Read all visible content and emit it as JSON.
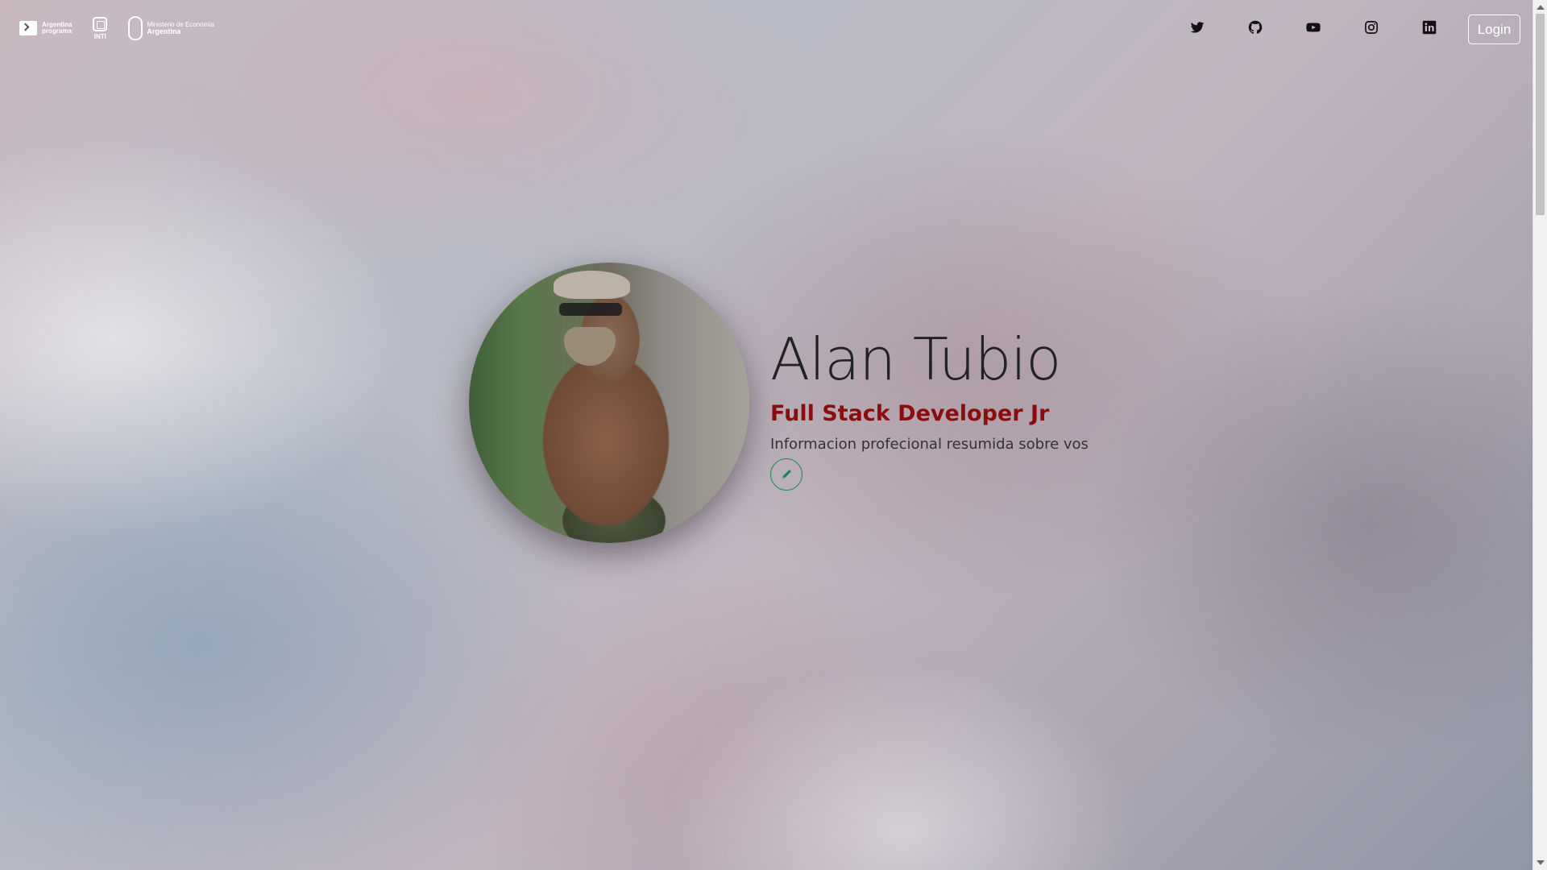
{
  "header": {
    "logos": {
      "argentina_programa": "Argentina\nprograma",
      "inti": "INTI",
      "ministerio_line1": "Ministerio de Economía",
      "ministerio_line2": "Argentina"
    },
    "social_icons": [
      "twitter-icon",
      "github-icon",
      "youtube-icon",
      "instagram-icon",
      "linkedin-icon"
    ],
    "login_label": "Login"
  },
  "profile": {
    "name": "Alan Tubio",
    "role": "Full Stack Developer Jr",
    "summary": "Informacion profecional resumida sobre vos",
    "edit_icon": "pencil-icon"
  },
  "colors": {
    "role_text": "#8b0e0e",
    "edit_button_border": "#198754",
    "login_border": "#ffffff"
  }
}
